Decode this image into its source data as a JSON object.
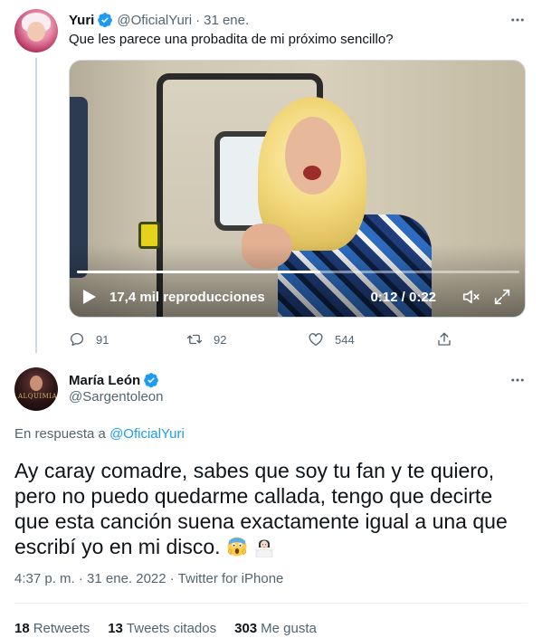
{
  "colors": {
    "link": "#1d9bf0",
    "text": "#0f1419",
    "secondary": "#536471",
    "verified": "#1d9bf0"
  },
  "parent_tweet": {
    "author_name": "Yuri",
    "handle": "@OficialYuri",
    "separator": "·",
    "date": "31 ene.",
    "text": "Que les parece una probadita de mi próximo sencillo?",
    "video": {
      "views": "17,4 mil reproducciones",
      "time": "0:12 / 0:22",
      "progress_fraction": 0.55
    },
    "actions": {
      "replies": "91",
      "retweets": "92",
      "likes": "544"
    },
    "icons": [
      "verified-badge-icon",
      "more-icon",
      "play-icon",
      "mute-icon",
      "fullscreen-icon",
      "reply-icon",
      "retweet-icon",
      "like-icon",
      "share-icon"
    ]
  },
  "main_tweet": {
    "author_name": "María León",
    "handle": "@Sargentoleon",
    "avatar_text": "ALQUIMIA",
    "reply_prefix": "En respuesta a",
    "reply_mention": "@OficialYuri",
    "text_lines": [
      "Ay caray comadre, sabes que soy tu fan y te quiero,",
      "pero no puedo quedarme callada, tengo que decirte",
      "que esta canción suena exactamente igual a una que",
      "escribí yo en mi disco."
    ],
    "emojis": [
      "screaming-in-fear-emoji",
      "person-shrugging-emoji"
    ],
    "meta": "4:37 p. m. · 31 ene. 2022 · Twitter for iPhone",
    "stats": {
      "retweets_count": "18",
      "retweets_label": "Retweets",
      "quotes_count": "13",
      "quotes_label": "Tweets citados",
      "likes_count": "303",
      "likes_label": "Me gusta"
    }
  }
}
